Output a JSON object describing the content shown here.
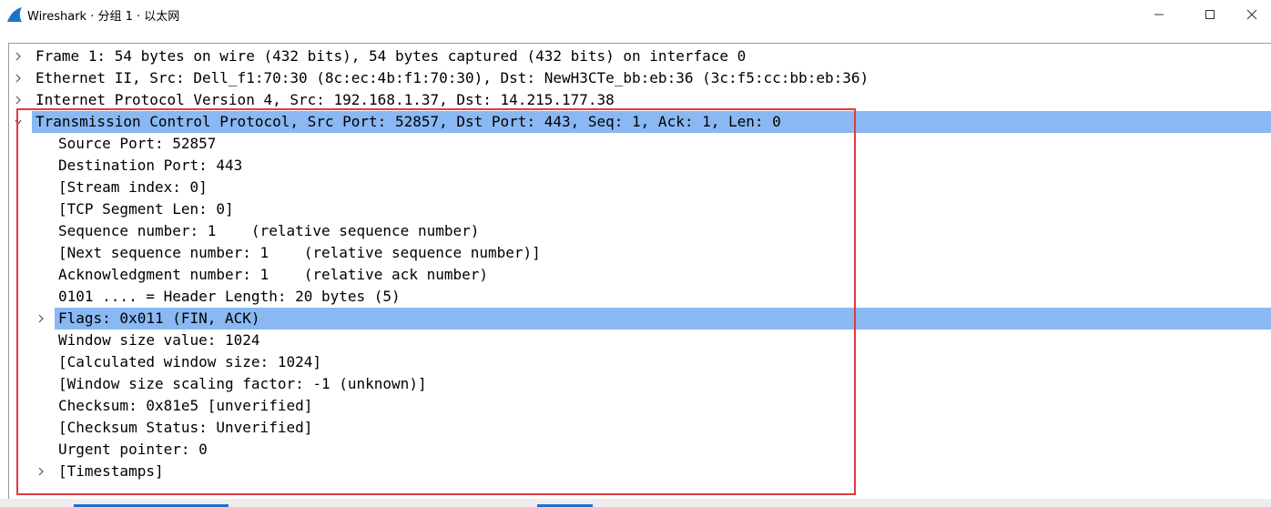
{
  "window": {
    "title": "Wireshark · 分组 1 · 以太网",
    "icons": {
      "app": "wireshark-fin-icon",
      "minimize": "minimize-icon",
      "maximize": "maximize-icon",
      "close": "close-icon"
    }
  },
  "tree": [
    {
      "text": "Frame 1: 54 bytes on wire (432 bits), 54 bytes captured (432 bits) on interface 0",
      "expander": "collapsed",
      "level": 0,
      "selected": false
    },
    {
      "text": "Ethernet II, Src: Dell_f1:70:30 (8c:ec:4b:f1:70:30), Dst: NewH3CTe_bb:eb:36 (3c:f5:cc:bb:eb:36)",
      "expander": "collapsed",
      "level": 0,
      "selected": false
    },
    {
      "text": "Internet Protocol Version 4, Src: 192.168.1.37, Dst: 14.215.177.38",
      "expander": "collapsed",
      "level": 0,
      "selected": false
    },
    {
      "text": "Transmission Control Protocol, Src Port: 52857, Dst Port: 443, Seq: 1, Ack: 1, Len: 0",
      "expander": "expanded",
      "level": 0,
      "selected": true
    },
    {
      "text": "Source Port: 52857",
      "expander": "none",
      "level": 1,
      "selected": false
    },
    {
      "text": "Destination Port: 443",
      "expander": "none",
      "level": 1,
      "selected": false
    },
    {
      "text": "[Stream index: 0]",
      "expander": "none",
      "level": 1,
      "selected": false
    },
    {
      "text": "[TCP Segment Len: 0]",
      "expander": "none",
      "level": 1,
      "selected": false
    },
    {
      "text": "Sequence number: 1    (relative sequence number)",
      "expander": "none",
      "level": 1,
      "selected": false
    },
    {
      "text": "[Next sequence number: 1    (relative sequence number)]",
      "expander": "none",
      "level": 1,
      "selected": false
    },
    {
      "text": "Acknowledgment number: 1    (relative ack number)",
      "expander": "none",
      "level": 1,
      "selected": false
    },
    {
      "text": "0101 .... = Header Length: 20 bytes (5)",
      "expander": "none",
      "level": 1,
      "selected": false
    },
    {
      "text": "Flags: 0x011 (FIN, ACK)",
      "expander": "collapsed",
      "level": 1,
      "selected": true
    },
    {
      "text": "Window size value: 1024",
      "expander": "none",
      "level": 1,
      "selected": false
    },
    {
      "text": "[Calculated window size: 1024]",
      "expander": "none",
      "level": 1,
      "selected": false
    },
    {
      "text": "[Window size scaling factor: -1 (unknown)]",
      "expander": "none",
      "level": 1,
      "selected": false
    },
    {
      "text": "Checksum: 0x81e5 [unverified]",
      "expander": "none",
      "level": 1,
      "selected": false
    },
    {
      "text": "[Checksum Status: Unverified]",
      "expander": "none",
      "level": 1,
      "selected": false
    },
    {
      "text": "Urgent pointer: 0",
      "expander": "none",
      "level": 1,
      "selected": false
    },
    {
      "text": "[Timestamps]",
      "expander": "collapsed",
      "level": 1,
      "selected": false
    }
  ],
  "colors": {
    "selection": "#89b8f3",
    "annotation_box": "#e3393f",
    "text": "#000000"
  }
}
